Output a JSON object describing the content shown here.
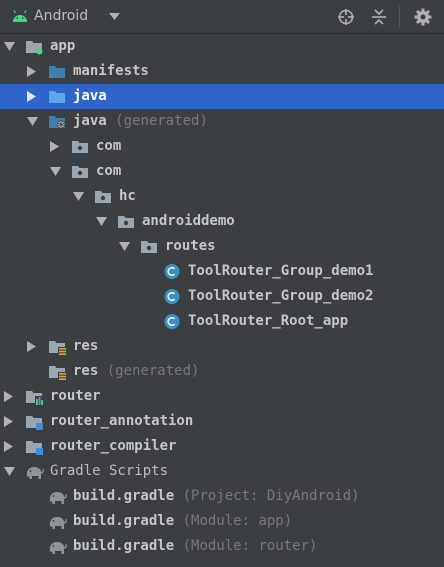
{
  "toolbar": {
    "view_mode": "Android",
    "icons": [
      "android-icon",
      "dropdown-caret-icon",
      "locate-icon",
      "collapse-all-icon",
      "settings-gear-icon"
    ]
  },
  "tree": {
    "app": "app",
    "manifests": "manifests",
    "java": "java",
    "java_generated": "java",
    "java_generated_hint": "(generated)",
    "com1": "com",
    "com2": "com",
    "hc": "hc",
    "androiddemo": "androiddemo",
    "routes": "routes",
    "class1": "ToolRouter_Group_demo1",
    "class2": "ToolRouter_Group_demo2",
    "class3": "ToolRouter_Root_app",
    "res": "res",
    "res_generated": "res",
    "res_generated_hint": "(generated)",
    "router": "router",
    "router_annotation": "router_annotation",
    "router_compiler": "router_compiler",
    "gradle_scripts": "Gradle Scripts",
    "build1": "build.gradle",
    "build1_hint": "(Project: DiyAndroid)",
    "build2": "build.gradle",
    "build2_hint": "(Module: app)",
    "build3": "build.gradle",
    "build3_hint": "(Module: router)"
  },
  "colors": {
    "background": "#3c3f41",
    "selection": "#2f65ca",
    "android_green": "#3ddc84",
    "folder_blue": "#3f7fa8",
    "class_badge": "#3a8fbf"
  }
}
